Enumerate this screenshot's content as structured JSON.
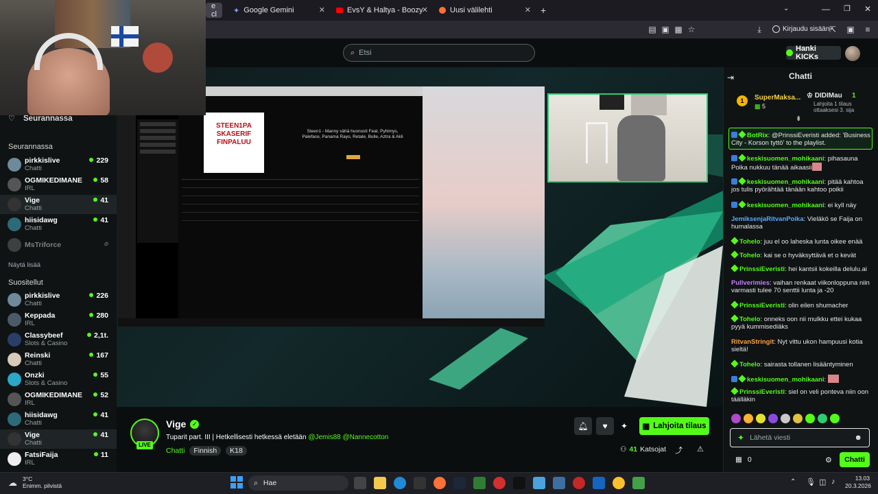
{
  "browser": {
    "tabs": [
      {
        "label": "e cl",
        "active": true
      },
      {
        "label": "Google Gemini"
      },
      {
        "label": "EvsY & Haltya - Boozy's Funky C"
      },
      {
        "label": "Uusi välilehti"
      }
    ],
    "login_label": "Kirjaudu sisään"
  },
  "kick": {
    "search_placeholder": "Etsi",
    "get_kicks": "Hanki KICKs",
    "following_header": "Seurannassa",
    "brand_color": "#53fc18"
  },
  "sidebar": {
    "following_title": "Seurannassa",
    "following": [
      {
        "name": "pirkkislive",
        "category": "Chatti",
        "viewers": "229"
      },
      {
        "name": "OGMIKEDIMANE",
        "category": "IRL",
        "viewers": "58"
      },
      {
        "name": "Vige",
        "category": "Chatti",
        "viewers": "41",
        "active": true
      },
      {
        "name": "hiisidawg",
        "category": "Chatti",
        "viewers": "41"
      },
      {
        "name": "MsTriforce",
        "category": "",
        "viewers": ""
      }
    ],
    "show_more": "Näytä lisää",
    "recommended_title": "Suositellut",
    "recommended": [
      {
        "name": "pirkkislive",
        "category": "Chatti",
        "viewers": "226"
      },
      {
        "name": "Keppada",
        "category": "IRL",
        "viewers": "280"
      },
      {
        "name": "Classybeef",
        "category": "Slots & Casino",
        "viewers": "2,1t."
      },
      {
        "name": "Reinski",
        "category": "Chatti",
        "viewers": "167"
      },
      {
        "name": "Onzki",
        "category": "Slots & Casino",
        "viewers": "55"
      },
      {
        "name": "OGMIKEDIMANE",
        "category": "IRL",
        "viewers": "52"
      },
      {
        "name": "hiisidawg",
        "category": "Chatti",
        "viewers": "41"
      },
      {
        "name": "Vige",
        "category": "Chatti",
        "viewers": "41",
        "active": true
      },
      {
        "name": "FatsiFaija",
        "category": "IRL",
        "viewers": "11"
      }
    ]
  },
  "player": {
    "playlist_banner": "STEEN1PA SKASERIF FINPALUU",
    "playlist_title": "Steen1 - Manny vähä huonosti Feat. Pyhimys, Paleface, Panama Rayo, Retale, Bulle, Aztra & Akli"
  },
  "stream": {
    "streamer": "Vige",
    "title": "Tuparit part. III | Hetkellisesti hetkessä eletään",
    "mentions": [
      "@Jemis88",
      "@Nannecotton"
    ],
    "category": "Chatti",
    "tags": [
      "Finnish",
      "K18"
    ],
    "live": "LIVE",
    "viewers": "41",
    "viewers_label": "Katsojat",
    "gift_label": "Lahjoita tilaus"
  },
  "chat": {
    "title": "Chatti",
    "leaderboard": [
      {
        "rank": "1",
        "name": "SuperMaksa...",
        "value": "5"
      },
      {
        "name": "DIDIMau",
        "value": "1",
        "note": "Lahjoita 1 tilaus ottaaksesi 3. sija"
      }
    ],
    "messages": [
      {
        "user": "BotRix",
        "text": ": @PrinssiEveristi added: 'Business City - Korson tyttö' to the playlist."
      },
      {
        "user": "keskisuomen_mohikaani",
        "text": ": pihasauna Poika nukkuu tänää aikaasii"
      },
      {
        "user": "keskisuomen_mohikaani",
        "text": ": pitää kahtoa jos tulis pyörähtää tänään kahtoo poikii"
      },
      {
        "user": "keskisuomen_mohikaani",
        "text": ": ei kyll näy"
      },
      {
        "user": "JemiksenjaRitvanPoika",
        "text": ": Vieläkö se Faija on humalassa"
      },
      {
        "user": "Tohelo",
        "text": ": juu el oo laheska lunta oikee enää"
      },
      {
        "user": "Tohelo",
        "text": ": kai se o hyväksyttävä et o kevät"
      },
      {
        "user": "PrinssiEveristi",
        "text": ": hei kantsii kokeilla delulu.ai"
      },
      {
        "user": "Pullverimies",
        "text": ": vaihan renkaat viikonloppuna niin varmasti tulee 70 senttii lunta ja -20"
      },
      {
        "user": "PrinssiEveristi",
        "text": ": olin eilen shumacher"
      },
      {
        "user": "Tohelo",
        "text": ": onneks oon nii mulkku ettei kukaa pyyä kummisediäks"
      },
      {
        "user": "RitvanStringit",
        "text": ": Nyt vittu ukon hampuusi kotia sieltä!"
      },
      {
        "user": "Tohelo",
        "text": ": sairasta tollanen lisääntyminen"
      },
      {
        "user": "keskisuomen_mohikaani",
        "text": ":"
      },
      {
        "user": "PrinssiEveristi",
        "text": ": siel on veli ponteva niin oon täälläkin"
      }
    ],
    "input_placeholder": "Lähetä viesti",
    "points": "0",
    "send_label": "Chatti"
  },
  "taskbar": {
    "weather_temp": "3°C",
    "weather_desc": "Enimm. pilvistä",
    "search_label": "Hae",
    "time": "13.03",
    "date": "20.3.2026"
  }
}
